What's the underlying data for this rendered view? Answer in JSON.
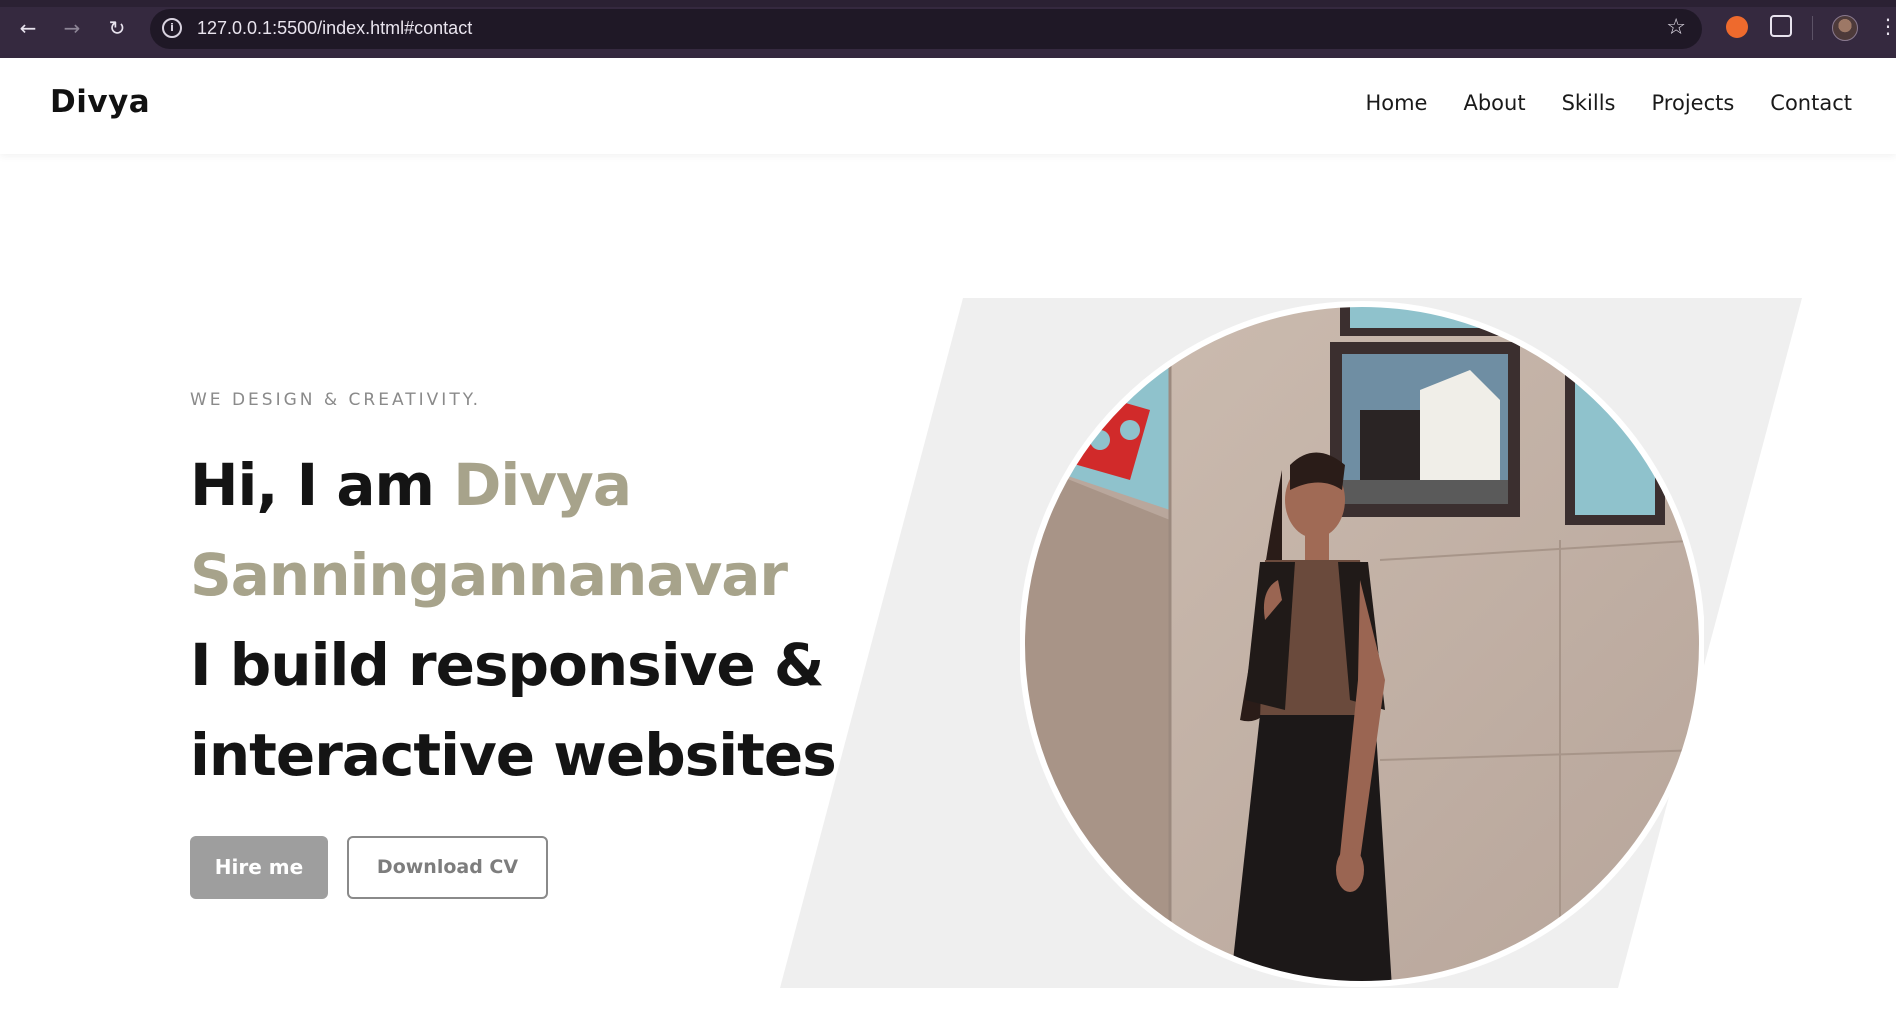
{
  "browser": {
    "url": "127.0.0.1:5500/index.html#contact",
    "icons": [
      "back-arrow-icon",
      "forward-arrow-icon",
      "reload-icon",
      "site-info-icon",
      "bookmark-star-icon",
      "extension-icon",
      "puzzle-extensions-icon",
      "profile-avatar",
      "more-menu-icon"
    ]
  },
  "site": {
    "logo": "Divya",
    "nav": [
      "Home",
      "About",
      "Skills",
      "Projects",
      "Contact"
    ]
  },
  "hero": {
    "kicker": "WE DESIGN & CREATIVITY.",
    "greeting": "Hi, I am ",
    "name_first": "Divya",
    "name_last": "Sanningannanavar",
    "line1": "I build responsive &",
    "line2": "interactive websites",
    "hire_label": "Hire me",
    "cv_label": "Download CV"
  },
  "colors": {
    "accent": "#a7a38b",
    "panel": "#efefef",
    "chrome": "#35293f"
  }
}
